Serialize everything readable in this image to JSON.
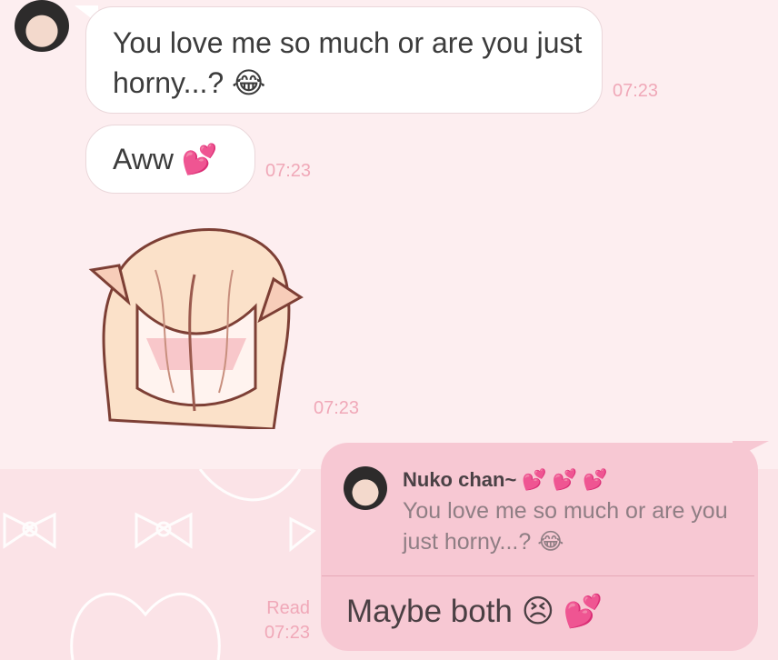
{
  "messages": [
    {
      "text": "You love me so much or are you just horny...? 😂",
      "time": "07:23"
    },
    {
      "text": "Aww 💕",
      "time": "07:23"
    },
    {
      "sticker": "blushing-catgirl-sticker",
      "time": "07:23"
    }
  ],
  "reply": {
    "quoted_name": "Nuko chan~ 💕 💕 💕",
    "quoted_text": "You love me so much or are you just horny...? 😂",
    "text": "Maybe both 😣 💕",
    "read_label": "Read",
    "time": "07:23"
  },
  "colors": {
    "background": "#fdeef0",
    "bubble_incoming": "#ffffff",
    "bubble_outgoing": "#f7c8d3",
    "timestamp": "#f0a8b8"
  }
}
